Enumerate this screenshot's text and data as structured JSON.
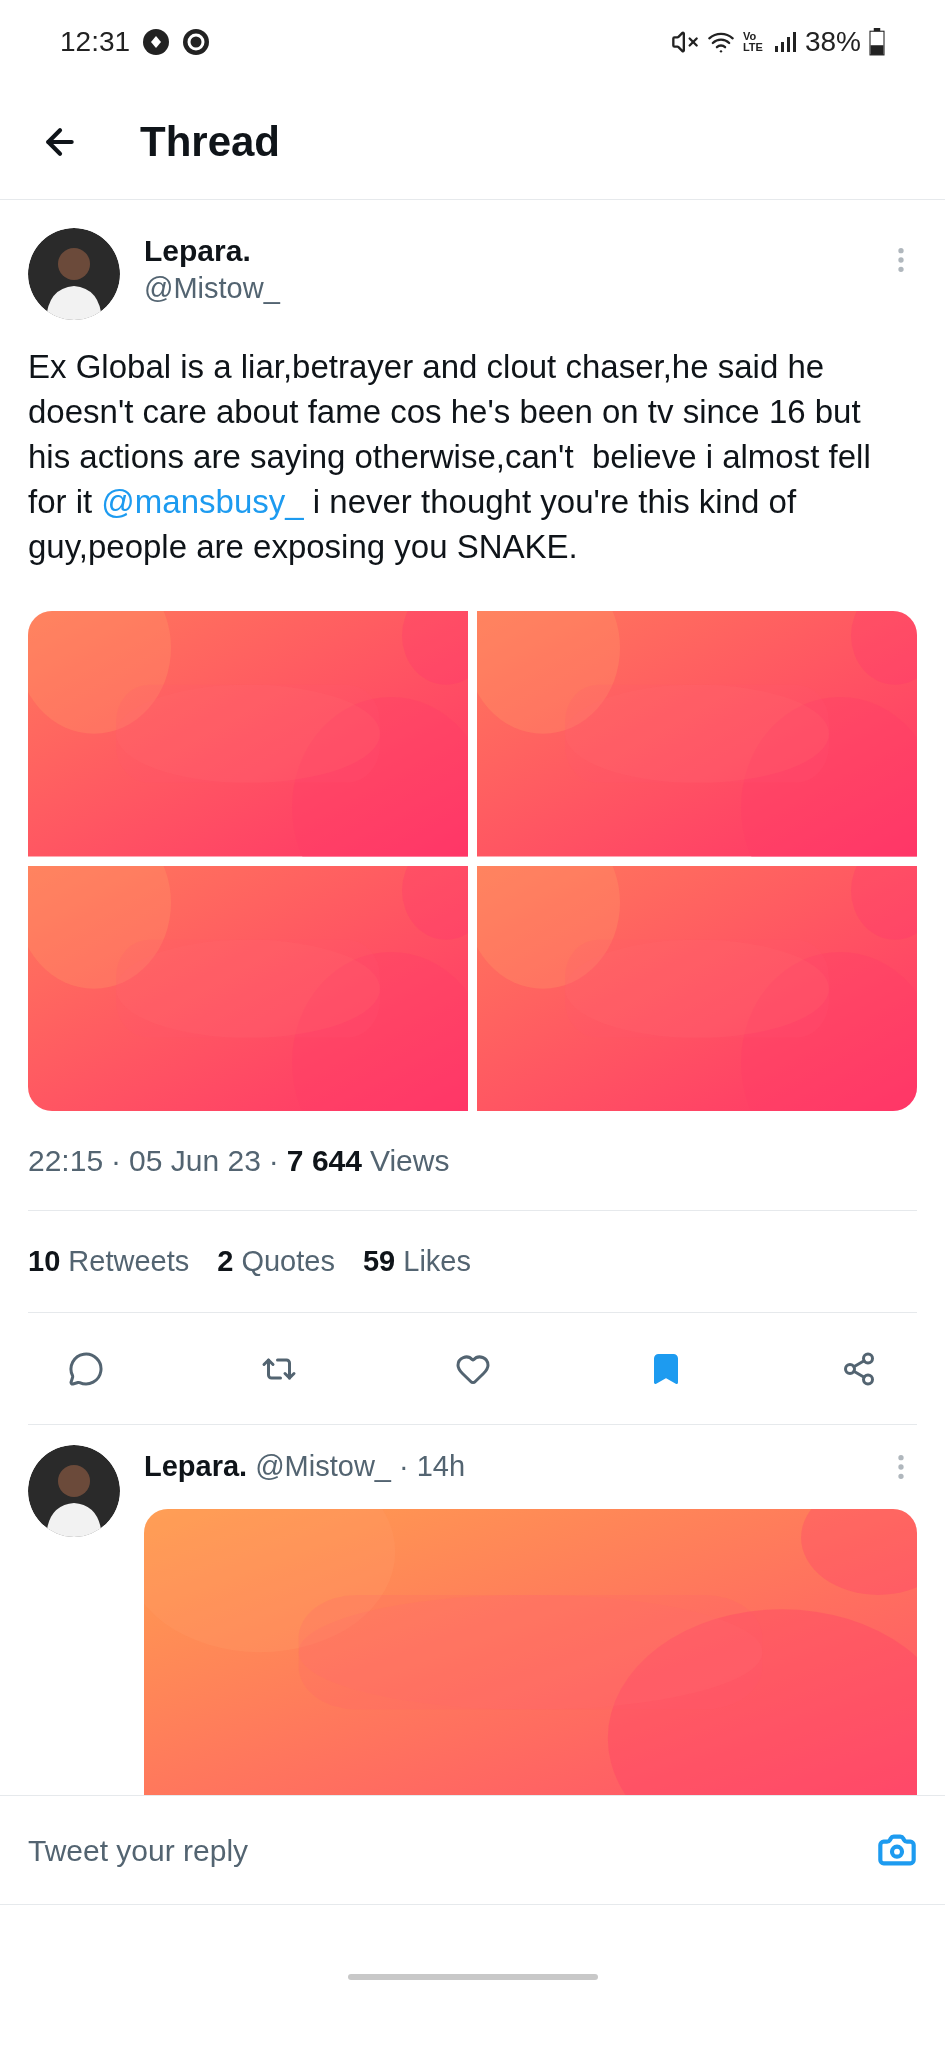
{
  "status_bar": {
    "time": "12:31",
    "network": "Vo LTE",
    "battery": "38%"
  },
  "header": {
    "title": "Thread"
  },
  "tweet": {
    "name": "Lepara.",
    "handle": "@Mistow_",
    "text": [
      {
        "kind": "plain",
        "text": "Ex Global is a liar,betrayer and clout chaser,he said he doesn't care about fame cos he's been on tv since 16 but his actions are saying otherwise,can't  believe i almost fell for it "
      },
      {
        "kind": "mention",
        "text": "@mansbusy_"
      },
      {
        "kind": "plain",
        "text": " i never thought you're this kind of guy,people are exposing you SNAKE."
      }
    ],
    "separator": "·",
    "time": "22:15",
    "date": "05 Jun 23",
    "views_count": "7 644",
    "views_label": "Views",
    "stats": [
      {
        "count": "10",
        "label": "Retweets"
      },
      {
        "count": "2",
        "label": "Quotes"
      },
      {
        "count": "59",
        "label": "Likes"
      }
    ],
    "actions": [
      {
        "kind": "reply",
        "on": false
      },
      {
        "kind": "retweet",
        "on": false
      },
      {
        "kind": "like",
        "on": false
      },
      {
        "kind": "bookmark",
        "on": true
      },
      {
        "kind": "share",
        "on": false
      }
    ]
  },
  "reply": {
    "name": "Lepara.",
    "handle": "@Mistow_",
    "separator": "·",
    "age": "14h"
  },
  "composer": {
    "placeholder": "Tweet your reply"
  }
}
